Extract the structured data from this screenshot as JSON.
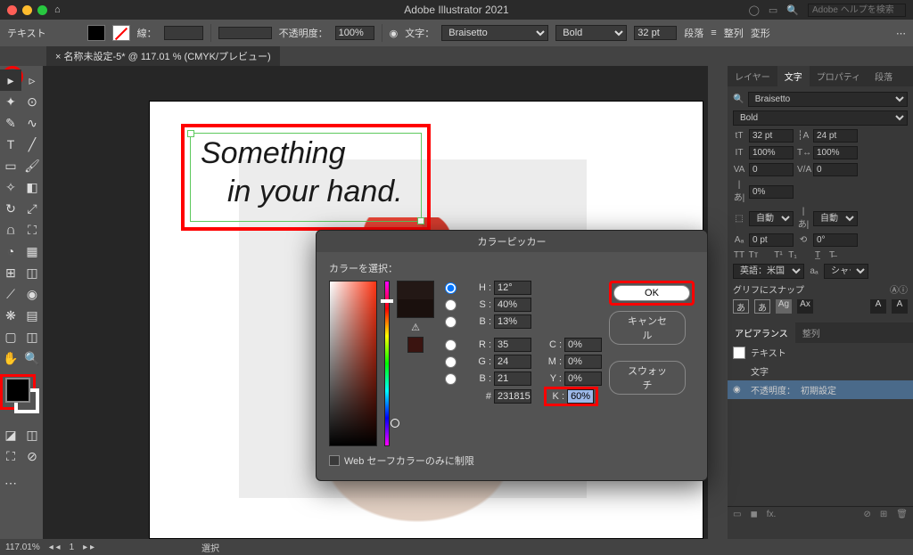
{
  "os": {
    "title": "Adobe Illustrator 2021",
    "search_placeholder": "Adobe ヘルプを検索"
  },
  "ctrl": {
    "label_text": "テキスト",
    "stroke_label": "線：",
    "opacity_label": "不透明度：",
    "opacity_value": "100%",
    "char_label": "文字：",
    "font": "Braisetto",
    "weight": "Bold",
    "size": "32 pt",
    "para_label": "段落",
    "align_label": "整列",
    "transform_label": "変形"
  },
  "tab": {
    "name": "× 名称未設定-5* @ 117.01 % (CMYK/プレビュー)"
  },
  "canvas": {
    "text_line1": "Something",
    "text_line2": "in your hand."
  },
  "char_panel": {
    "tabs": [
      "レイヤー",
      "文字",
      "プロパティ",
      "段落"
    ],
    "font": "Braisetto",
    "weight": "Bold",
    "size": "32 pt",
    "leading": "24 pt",
    "vscale": "100%",
    "hscale": "100%",
    "tracking": "0",
    "kerning_label": "自動",
    "kerning2": "自動",
    "baseline": "0 pt",
    "rotation": "0°",
    "aki": "0%",
    "lang": "英語：米国",
    "aa": "シャープ",
    "snap": "グリフにスナップ"
  },
  "appearance": {
    "tabs": [
      "アピアランス",
      "整列"
    ],
    "row_text": "テキスト",
    "row_char": "文字",
    "row_opacity_label": "不透明度：",
    "row_opacity_value": "初期設定"
  },
  "picker": {
    "title": "カラーピッカー",
    "select_label": "カラーを選択：",
    "ok": "OK",
    "cancel": "キャンセル",
    "swatches": "スウォッチ",
    "H": "12°",
    "S": "40%",
    "B": "13%",
    "R": "35",
    "G": "24",
    "Bb": "21",
    "C": "0%",
    "M": "0%",
    "Y": "0%",
    "K": "60%",
    "hex": "231815",
    "web": "Web セーフカラーのみに制限"
  },
  "status": {
    "zoom": "117.01%",
    "page": "1",
    "sel": "選択"
  }
}
